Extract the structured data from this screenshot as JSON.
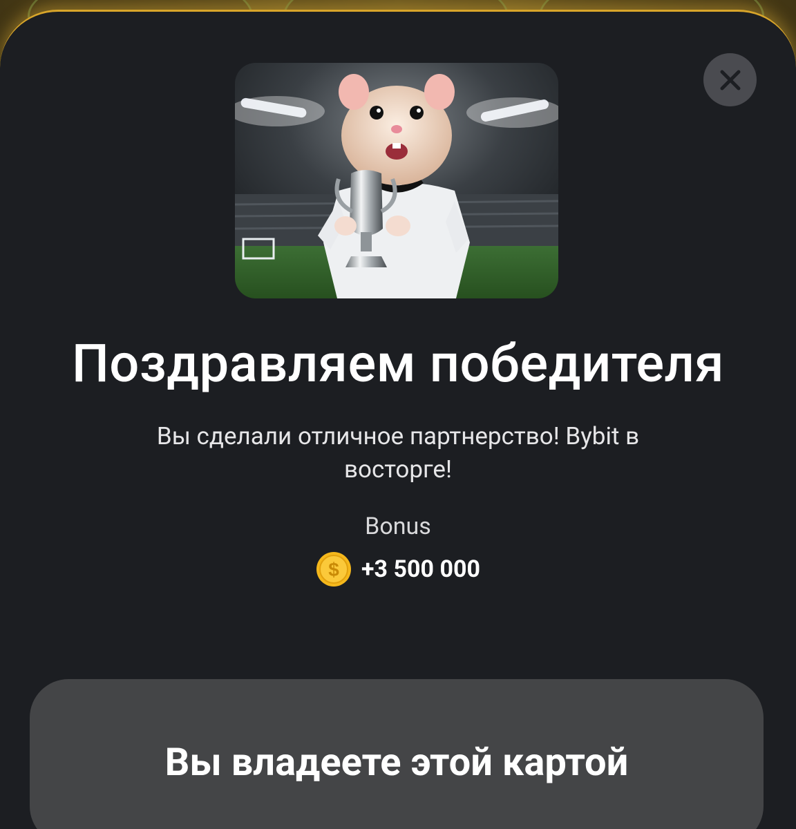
{
  "modal": {
    "title": "Поздравляем победителя",
    "description": "Вы сделали отличное партнерство! Bybit в восторге!",
    "bonus": {
      "label": "Bonus",
      "icon": "dollar-coin-icon",
      "amount": "+3 500 000"
    },
    "action_button_label": "Вы владеете этой картой",
    "close_icon": "close-icon",
    "image_icon": "hamster-champion-card-image"
  },
  "colors": {
    "sheet_background": "#1c1e22",
    "sheet_border_glow": "#d8a52a",
    "button_background": "#444547",
    "close_button_background": "#4a4b50",
    "coin": "#f5b81c",
    "text_primary": "#ffffff"
  }
}
